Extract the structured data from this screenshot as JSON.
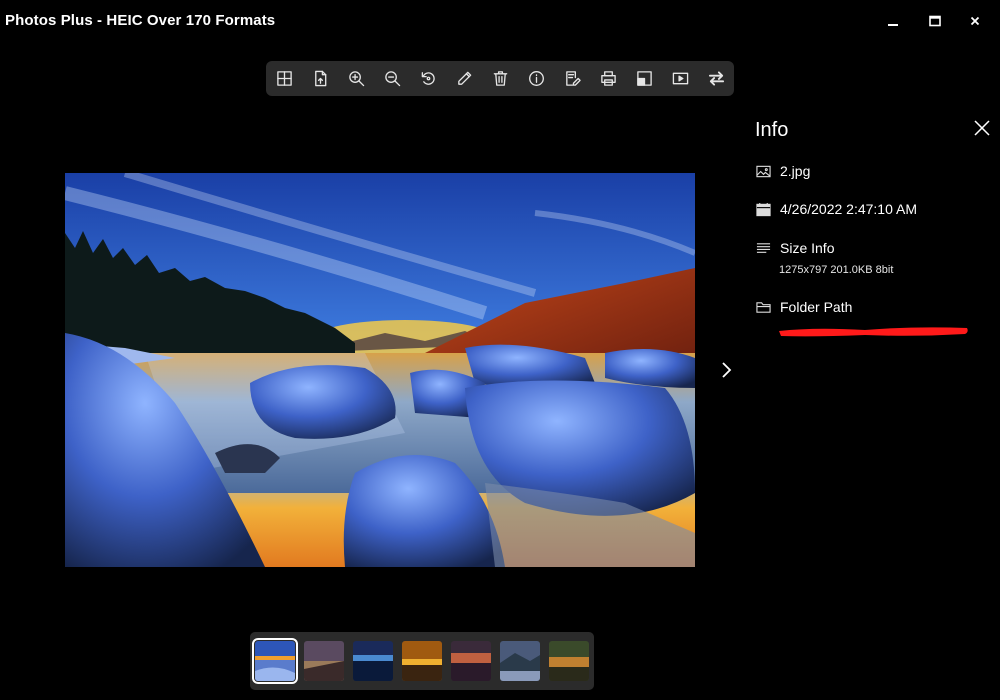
{
  "window": {
    "title": "Photos Plus - HEIC Over 170 Formats",
    "controls": [
      "minimize-icon",
      "maximize-icon",
      "close-icon"
    ]
  },
  "toolbar": {
    "tools": [
      {
        "name": "grid-view-icon"
      },
      {
        "name": "open-file-icon"
      },
      {
        "name": "zoom-in-icon"
      },
      {
        "name": "zoom-out-icon"
      },
      {
        "name": "rotate-icon"
      },
      {
        "name": "edit-pencil-icon"
      },
      {
        "name": "delete-icon"
      },
      {
        "name": "info-icon"
      },
      {
        "name": "rename-icon"
      },
      {
        "name": "print-icon"
      },
      {
        "name": "set-wallpaper-icon"
      },
      {
        "name": "slideshow-icon"
      },
      {
        "name": "convert-icon"
      }
    ]
  },
  "image": {
    "description": ""
  },
  "info": {
    "title": "Info",
    "filename": "2.jpg",
    "date": "4/26/2022 2:47:10 AM",
    "size_label": "Size Info",
    "size_detail": "1275x797  201.0KB  8bit",
    "folder_label": "Folder Path"
  },
  "filmstrip": {
    "thumbnails": [
      "thumb-1",
      "thumb-2",
      "thumb-3",
      "thumb-4",
      "thumb-5",
      "thumb-6",
      "thumb-7"
    ],
    "active_index": 0
  },
  "colors": {
    "background": "#000000",
    "panel": "#2b2b2b",
    "redaction": "#ff1a1a"
  }
}
